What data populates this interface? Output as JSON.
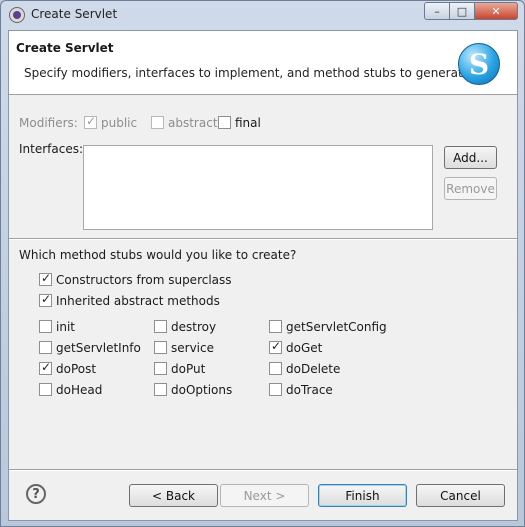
{
  "window": {
    "title": "Create Servlet",
    "minimize": "–",
    "maximize": "□",
    "close": "✕"
  },
  "header": {
    "title": "Create Servlet",
    "description": "Specify modifiers, interfaces to implement, and method stubs to generate.",
    "logo_letter": "S"
  },
  "modifiers": {
    "label": "Modifiers:",
    "public": "public",
    "abstract": "abstract",
    "final": "final"
  },
  "interfaces": {
    "label": "Interfaces:",
    "add": "Add...",
    "remove": "Remove"
  },
  "stubs": {
    "question": "Which method stubs would you like to create?",
    "constructors": "Constructors from superclass",
    "inherited": "Inherited abstract methods",
    "methods": [
      "init",
      "destroy",
      "getServletConfig",
      "getServletInfo",
      "service",
      "doGet",
      "doPost",
      "doPut",
      "doDelete",
      "doHead",
      "doOptions",
      "doTrace"
    ]
  },
  "footer": {
    "help": "?",
    "back": "< Back",
    "next": "Next >",
    "finish": "Finish",
    "cancel": "Cancel"
  }
}
